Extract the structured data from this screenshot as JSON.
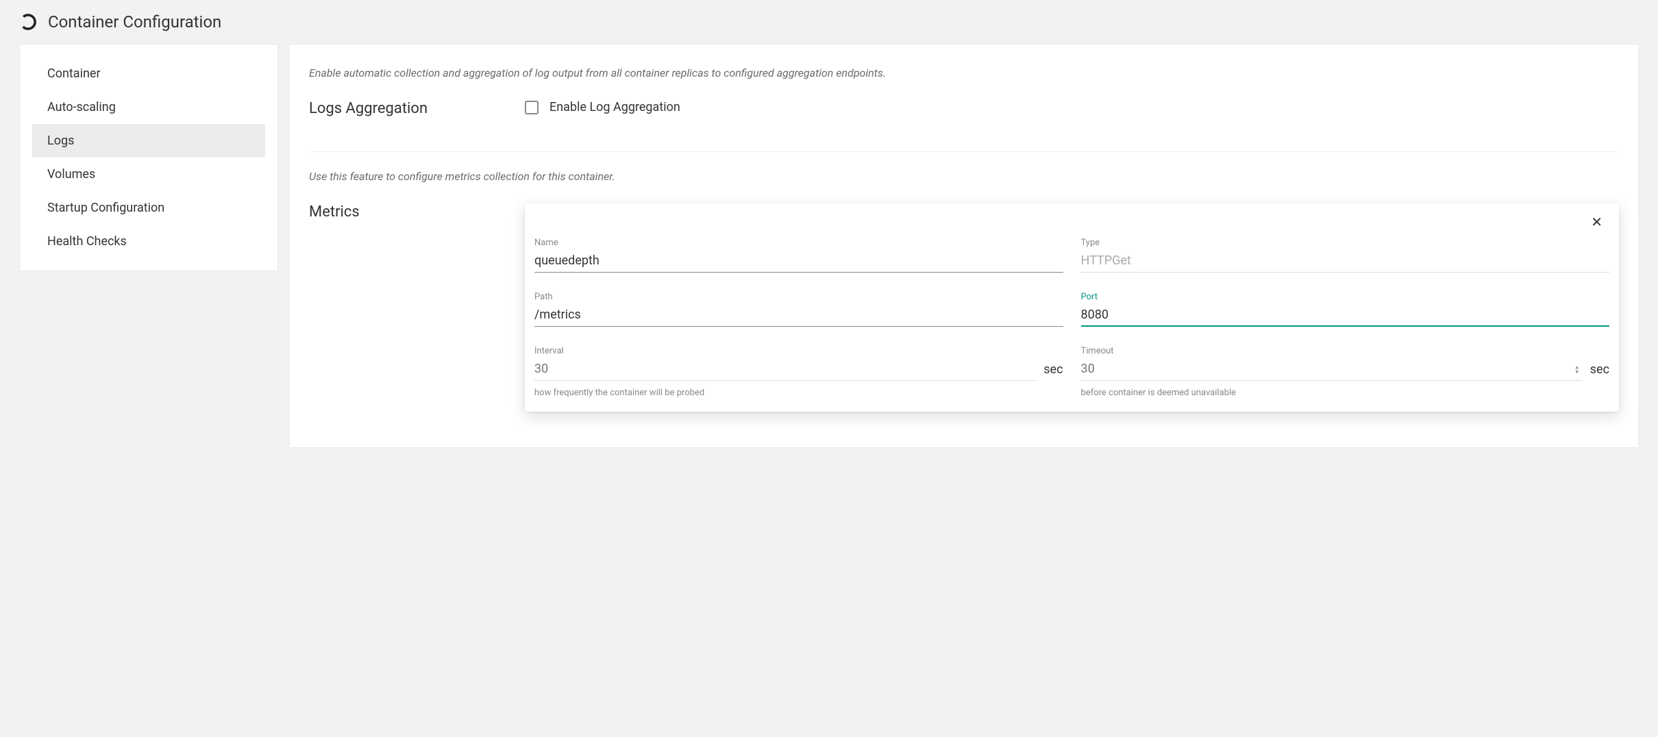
{
  "header": {
    "title": "Container Configuration"
  },
  "sidebar": {
    "items": [
      {
        "label": "Container",
        "active": false
      },
      {
        "label": "Auto-scaling",
        "active": false
      },
      {
        "label": "Logs",
        "active": true
      },
      {
        "label": "Volumes",
        "active": false
      },
      {
        "label": "Startup Configuration",
        "active": false
      },
      {
        "label": "Health Checks",
        "active": false
      }
    ]
  },
  "logs": {
    "desc": "Enable automatic collection and aggregation of log output from all container replicas to configured aggregation endpoints.",
    "title": "Logs Aggregation",
    "checkbox_label": "Enable Log Aggregation"
  },
  "metrics": {
    "desc": "Use this feature to configure metrics collection for this container.",
    "title": "Metrics",
    "card": {
      "name": {
        "label": "Name",
        "value": "queuedepth"
      },
      "type": {
        "label": "Type",
        "value": "HTTPGet"
      },
      "path": {
        "label": "Path",
        "value": "/metrics"
      },
      "port": {
        "label": "Port",
        "value": "8080"
      },
      "interval": {
        "label": "Interval",
        "placeholder": "30",
        "suffix": "sec",
        "help": "how frequently the container will be probed"
      },
      "timeout": {
        "label": "Timeout",
        "placeholder": "30",
        "suffix": "sec",
        "help": "before container is deemed unavailable"
      }
    }
  }
}
